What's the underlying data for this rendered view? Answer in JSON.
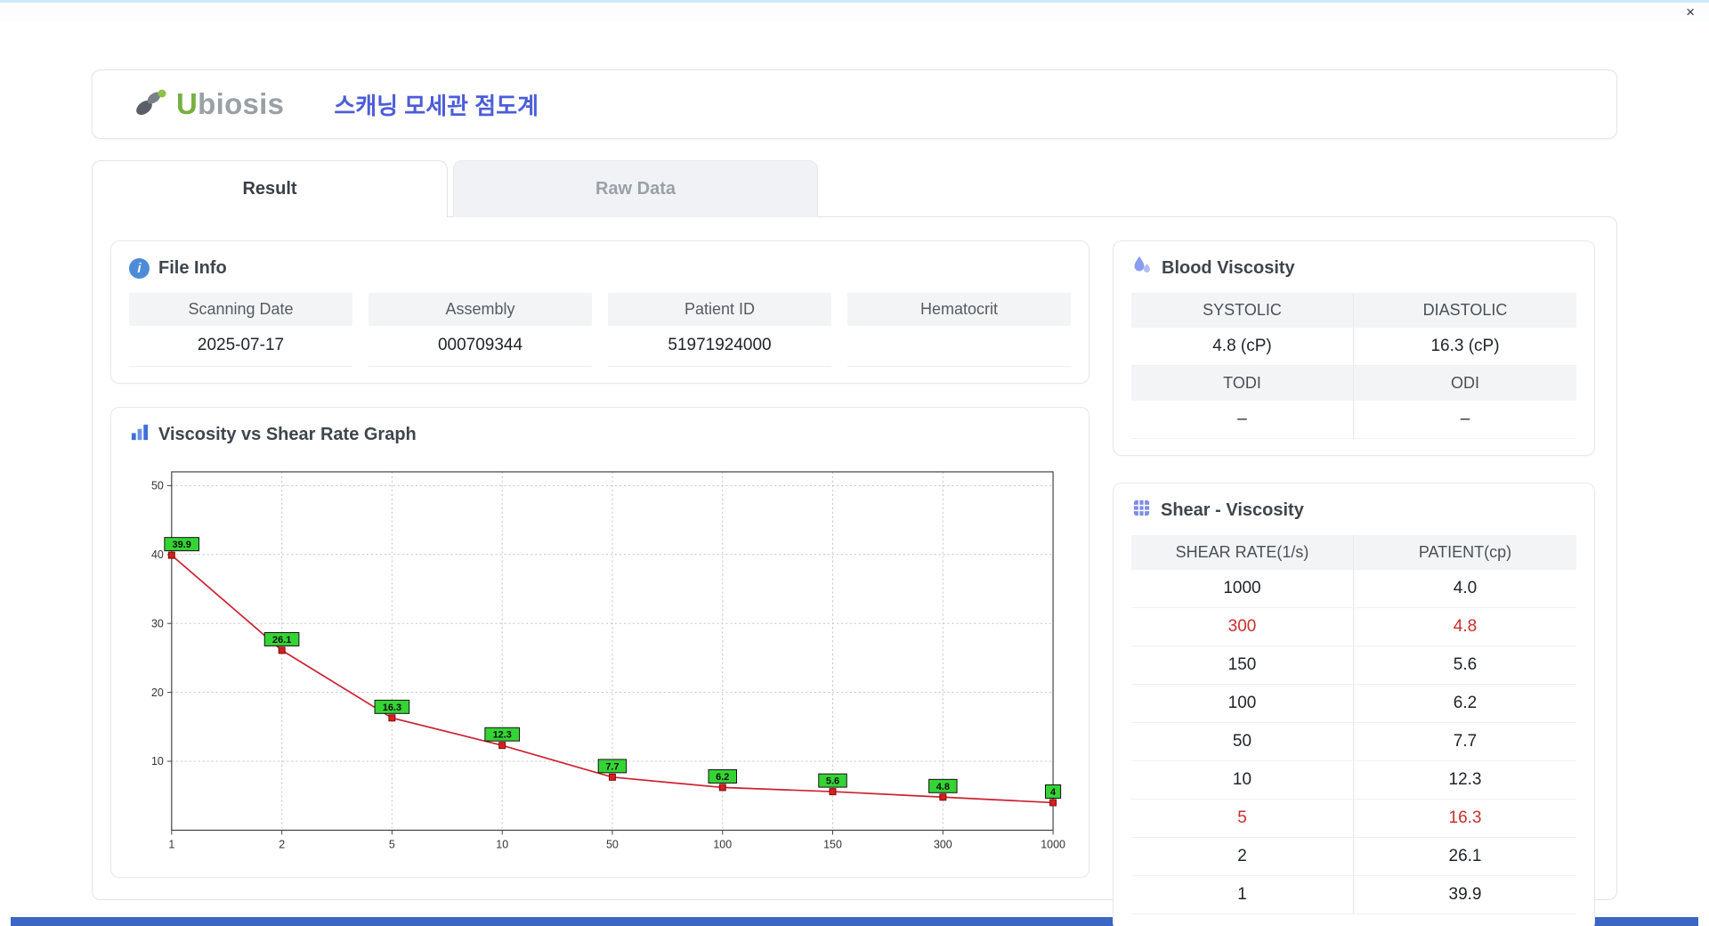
{
  "icons": {
    "info_glyph": "i",
    "close_glyph": "×"
  },
  "header": {
    "logo_u": "U",
    "logo_rest": "biosis",
    "title": "스캐닝 모세관 점도계"
  },
  "tabs": [
    {
      "label": "Result",
      "active": true
    },
    {
      "label": "Raw Data",
      "active": false
    }
  ],
  "file_info": {
    "title": "File Info",
    "fields": [
      {
        "label": "Scanning Date",
        "value": "2025-07-17"
      },
      {
        "label": "Assembly",
        "value": "000709344"
      },
      {
        "label": "Patient ID",
        "value": "51971924000"
      },
      {
        "label": "Hematocrit",
        "value": ""
      }
    ]
  },
  "blood_viscosity": {
    "title": "Blood Viscosity",
    "rows": [
      {
        "headers": [
          "SYSTOLIC",
          "DIASTOLIC"
        ],
        "values": [
          "4.8 (cP)",
          "16.3 (cP)"
        ]
      },
      {
        "headers": [
          "TODI",
          "ODI"
        ],
        "values": [
          "–",
          "–"
        ]
      }
    ]
  },
  "graph": {
    "title": "Viscosity vs Shear Rate Graph"
  },
  "chart_data": {
    "type": "line",
    "title": "Viscosity vs Shear Rate Graph",
    "x": [
      1,
      2,
      5,
      10,
      50,
      100,
      150,
      300,
      1000
    ],
    "values": [
      39.9,
      26.1,
      16.3,
      12.3,
      7.7,
      6.2,
      5.6,
      4.8,
      4.0
    ],
    "point_labels": [
      "39.9",
      "26.1",
      "16.3",
      "12.3",
      "7.7",
      "6.2",
      "5.6",
      "4.8",
      "4"
    ],
    "xlabel": "",
    "ylabel": "",
    "x_scale": "category",
    "ylim": [
      0,
      52
    ],
    "yticks": [
      10,
      20,
      30,
      40,
      50
    ],
    "grid": true,
    "legend": false,
    "line_color": "#cc2231",
    "marker_fill": "#d91e1e",
    "marker_border": "#7a0c0c",
    "label_bg": "#35d435",
    "label_border": "#111111"
  },
  "shear_table": {
    "title": "Shear - Viscosity",
    "columns": [
      "SHEAR RATE(1/s)",
      "PATIENT(cp)"
    ],
    "rows": [
      {
        "shear": "1000",
        "patient": "4.0",
        "highlight": false
      },
      {
        "shear": "300",
        "patient": "4.8",
        "highlight": true
      },
      {
        "shear": "150",
        "patient": "5.6",
        "highlight": false
      },
      {
        "shear": "100",
        "patient": "6.2",
        "highlight": false
      },
      {
        "shear": "50",
        "patient": "7.7",
        "highlight": false
      },
      {
        "shear": "10",
        "patient": "12.3",
        "highlight": false
      },
      {
        "shear": "5",
        "patient": "16.3",
        "highlight": true
      },
      {
        "shear": "2",
        "patient": "26.1",
        "highlight": false
      },
      {
        "shear": "1",
        "patient": "39.9",
        "highlight": false
      }
    ]
  },
  "colors": {
    "accent_blue": "#4d5dd8",
    "highlight": "#c9302c",
    "header_gray": "#f3f4f6",
    "taskbar_blue": "#3b66c4"
  }
}
